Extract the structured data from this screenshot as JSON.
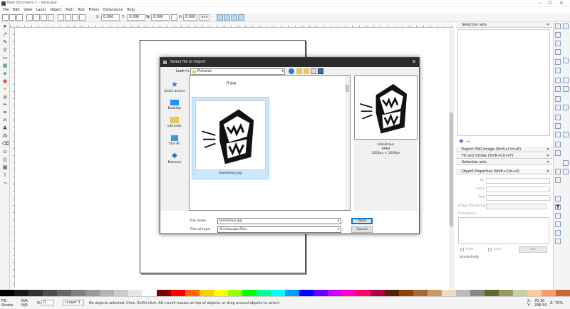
{
  "window": {
    "title": "New document 1 - Inkscape",
    "min": "—",
    "max": "☐",
    "close": "✕"
  },
  "menu": [
    "File",
    "Edit",
    "View",
    "Layer",
    "Object",
    "Path",
    "Text",
    "Filters",
    "Extensions",
    "Help"
  ],
  "toolctrl": {
    "x_label": "X:",
    "x": "0.000",
    "y_label": "Y:",
    "y": "0.000",
    "w_label": "W:",
    "w": "0.000",
    "h_label": "H:",
    "h": "0.000",
    "unit": "mm"
  },
  "dialog": {
    "title": "Select file to import",
    "close": "✕",
    "lookin_label": "Look in:",
    "lookin_value": "Pictures",
    "places": [
      {
        "label": "Quick access",
        "icon": "star-icon"
      },
      {
        "label": "Desktop",
        "icon": "desktop-icon"
      },
      {
        "label": "Libraries",
        "icon": "libraries-icon"
      },
      {
        "label": "This PC",
        "icon": "computer-icon"
      },
      {
        "label": "Network",
        "icon": "network-icon"
      }
    ],
    "folder_entry": "ft.jpg",
    "selected_file": "blankhaus.jpg",
    "preview": {
      "name": "blankhaus",
      "size": "89kB",
      "dims": "1200px × 1200px"
    },
    "filename_label": "File name:",
    "filename_value": "blankhaus.jpg",
    "filetype_label": "Files of type:",
    "filetype_value": "All Inkscape Files",
    "open": "Open",
    "cancel": "Cancel"
  },
  "panels": {
    "selection_sets_top": "Selection sets",
    "export_png": "Export PNG Image (Shift+Ctrl+E)",
    "fill_stroke": "Fill and Stroke (Shift+Ctrl+F)",
    "selection_sets": "Selection sets",
    "object_props": "Object Properties (Shift+Ctrl+O)",
    "id_label": "ID",
    "label_label": "Label",
    "title_label": "Title",
    "image_rendering_label": "Image Rendering",
    "description_label": "Description",
    "hide_label": "Hide",
    "lock_label": "Lock",
    "set_label": "Set",
    "interactivity_label": "Interactivity"
  },
  "status": {
    "fill_label": "Fill:",
    "fill_value": "N/A",
    "stroke_label": "Stroke:",
    "stroke_value": "N/A",
    "opacity_label": "O:",
    "opacity_value": "0",
    "layer": "•Layer 1",
    "message": "No objects selected. Click, Shift+click, Alt+scroll mouse on top of objects, or drag around objects to select.",
    "x_label": "X:",
    "x_value": "70.30",
    "y_label": "Y:",
    "y_value": "296.50",
    "zoom_label": "Z:",
    "zoom_value": "70%"
  },
  "palette_colors": [
    "#000000",
    "#1a1a1a",
    "#333333",
    "#4d4d4d",
    "#666666",
    "#808080",
    "#999999",
    "#b3b3b3",
    "#cccccc",
    "#e6e6e6",
    "#ffffff",
    "#800000",
    "#ff0000",
    "#ff6600",
    "#ffcc00",
    "#ffff00",
    "#99ff00",
    "#00ff00",
    "#00ff99",
    "#00ffff",
    "#0099ff",
    "#0000ff",
    "#6600ff",
    "#cc00ff",
    "#ff00cc",
    "#ff0066",
    "#aa0044",
    "#552200",
    "#884400",
    "#aa6633",
    "#cc9966",
    "#eeddbb",
    "#bbbbbb",
    "#888888",
    "#666633",
    "#999966",
    "#ccccaa",
    "#ffcc99",
    "#ff9966",
    "#cc6633"
  ]
}
